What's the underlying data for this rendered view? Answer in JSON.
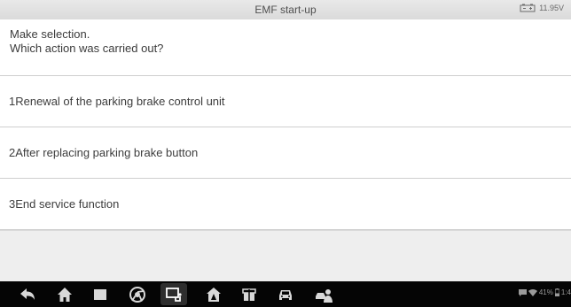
{
  "window": {
    "title": "EMF start-up",
    "voltage": "11.95V"
  },
  "prompt": {
    "line1": "Make selection.",
    "line2": "Which action was carried out?"
  },
  "options": [
    {
      "label": "1Renewal of the parking brake control unit"
    },
    {
      "label": "2After replacing parking brake button"
    },
    {
      "label": "3End service function"
    }
  ],
  "navbar": {
    "icons": [
      "back-icon",
      "home-icon",
      "recent-apps-icon",
      "browser-icon",
      "vci-connection-icon",
      "autel-home-icon",
      "shop-icon",
      "car-icon",
      "remote-support-icon"
    ],
    "status": {
      "battery_percent": "41%",
      "time": "1:4"
    }
  },
  "colors": {
    "titlebar": "#dadada",
    "navbar": "#050505",
    "divider": "#cfcfcf",
    "text": "#3a3a3a"
  }
}
